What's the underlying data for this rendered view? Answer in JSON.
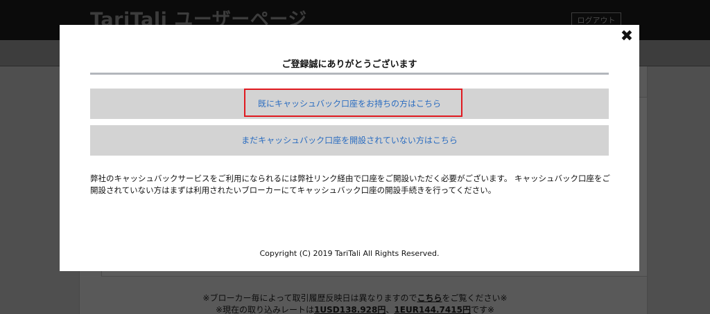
{
  "background": {
    "logo": "TariTali ユーザーページ",
    "logout_label": "ログアウト",
    "note_line1_before": "※ブローカー毎によって取引履歴反映日は異なりますので",
    "note_line1_link": "こちら",
    "note_line1_after": "をご覧ください※",
    "note_line2_before": "※現在の取り込みレートは",
    "note_line2_usd": "1USD138.928円",
    "note_line2_mid": "、",
    "note_line2_eur": "1EUR144.7415円",
    "note_line2_after": "です※"
  },
  "modal": {
    "close_glyph": "✖",
    "title": "ご登録誠にありがとうございます",
    "button_existing": "既にキャッシュバック口座をお持ちの方はこちら",
    "button_new": "まだキャッシュバック口座を開設されていない方はこちら",
    "description": "弊社のキャッシュバックサービスをご利用になられるには弊社リンク経由で口座をご開設いただく必要がございます。 キャッシュバック口座をご開設されていない方はまずは利用されたいブローカーにてキャッシュバック口座の開設手続きを行ってください。",
    "copyright": "Copyright (C) 2019 TariTali All Rights Reserved."
  },
  "colors": {
    "button_text": "#2a6cc0",
    "highlight": "#e0181e",
    "button_bg": "#d3d3d3"
  }
}
